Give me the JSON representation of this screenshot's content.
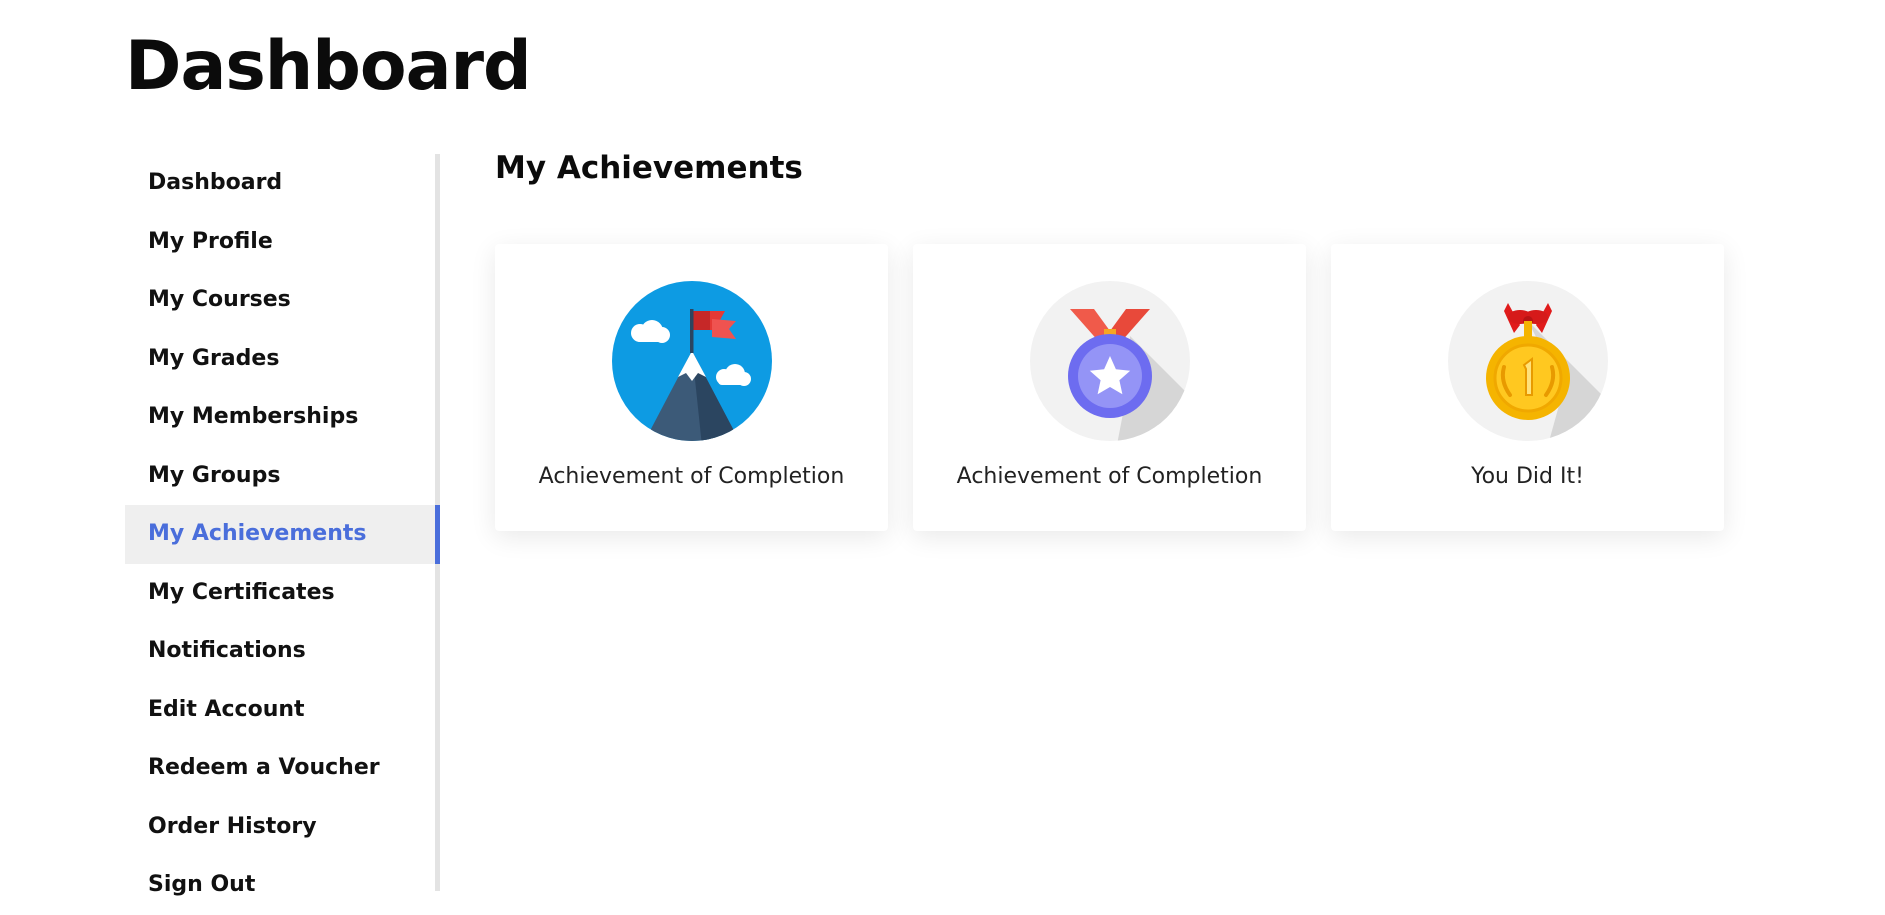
{
  "page": {
    "title": "Dashboard"
  },
  "sidebar": {
    "items": [
      {
        "label": "Dashboard"
      },
      {
        "label": "My Profile"
      },
      {
        "label": "My Courses"
      },
      {
        "label": "My Grades"
      },
      {
        "label": "My Memberships"
      },
      {
        "label": "My Groups"
      },
      {
        "label": "My Achievements",
        "active": true
      },
      {
        "label": "My Certificates"
      },
      {
        "label": "Notifications"
      },
      {
        "label": "Edit Account"
      },
      {
        "label": "Redeem a Voucher"
      },
      {
        "label": "Order History"
      },
      {
        "label": "Sign Out"
      }
    ]
  },
  "main": {
    "section_title": "My Achievements",
    "achievements": [
      {
        "title": "Achievement of Completion",
        "icon": "mountain-flag-icon"
      },
      {
        "title": "Achievement of Completion",
        "icon": "star-medal-icon"
      },
      {
        "title": "You Did It!",
        "icon": "gold-medal-icon"
      }
    ]
  },
  "colors": {
    "accent": "#4a6edb",
    "active_bg": "#efefef",
    "sidebar_border": "#e3e3e3"
  }
}
